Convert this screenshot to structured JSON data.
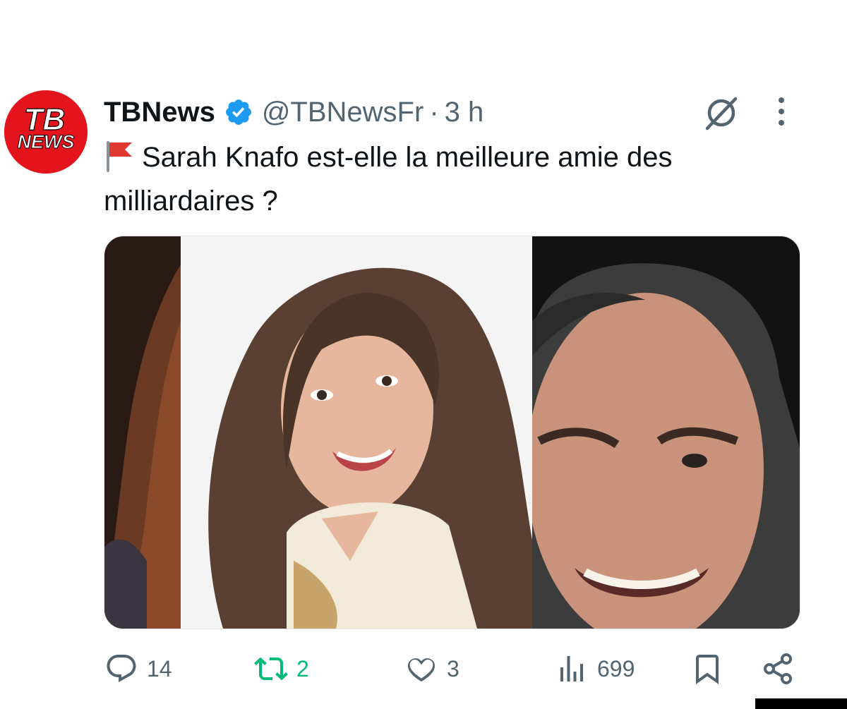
{
  "tweet": {
    "display_name": "TBNews",
    "handle": "@TBNewsFr",
    "separator": "·",
    "time": "3 h",
    "avatar_text": {
      "top": "TB",
      "bottom": "NEWS"
    },
    "verified_icon": "verified-badge-icon",
    "text": "Sarah Knafo est-elle la meilleure amie des milliardaires ?",
    "emoji": "triangular-flag-icon",
    "media": {
      "photos": [
        "woman-curly-hair-photo",
        "smiling-woman-photo",
        "smiling-man-photo"
      ]
    }
  },
  "actions": {
    "reply_count": "14",
    "repost_count": "2",
    "like_count": "3",
    "views_count": "699"
  },
  "colors": {
    "text": "#0f1419",
    "secondary": "#536471",
    "verified": "#1d9bf0",
    "repost_active": "#00ba7c",
    "avatar_bg": "#e3141b"
  }
}
